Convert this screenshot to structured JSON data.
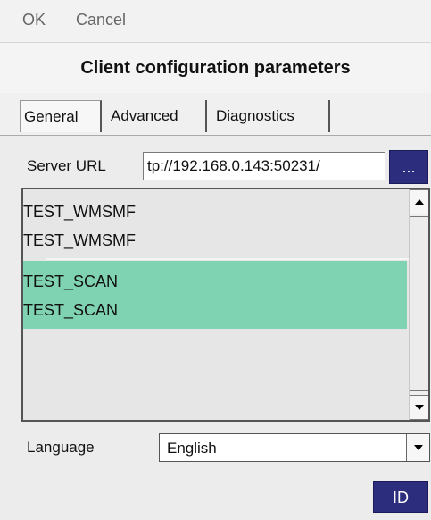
{
  "menu": {
    "ok": "OK",
    "cancel": "Cancel"
  },
  "dialog": {
    "title": "Client configuration parameters"
  },
  "tabs": [
    {
      "label": "General"
    },
    {
      "label": "Advanced"
    },
    {
      "label": "Diagnostics"
    }
  ],
  "server": {
    "label": "Server URL",
    "value": "tp://192.168.0.143:50231/",
    "browse_label": "..."
  },
  "list": {
    "items": [
      {
        "line1": "TEST_WMSMF",
        "line2": "TEST_WMSMF",
        "selected": false
      },
      {
        "line1": "TEST_SCAN",
        "line2": "TEST_SCAN",
        "selected": true
      }
    ]
  },
  "language": {
    "label": "Language",
    "value": "English"
  },
  "actions": {
    "id_label": "ID"
  },
  "colors": {
    "selection": "#7fd3b2",
    "button": "#2d2d7d",
    "background": "#f0f0f0"
  },
  "icons": {
    "scroll_up": "triangle-up-icon",
    "scroll_down": "triangle-down-icon",
    "dropdown": "chevron-down-icon"
  }
}
